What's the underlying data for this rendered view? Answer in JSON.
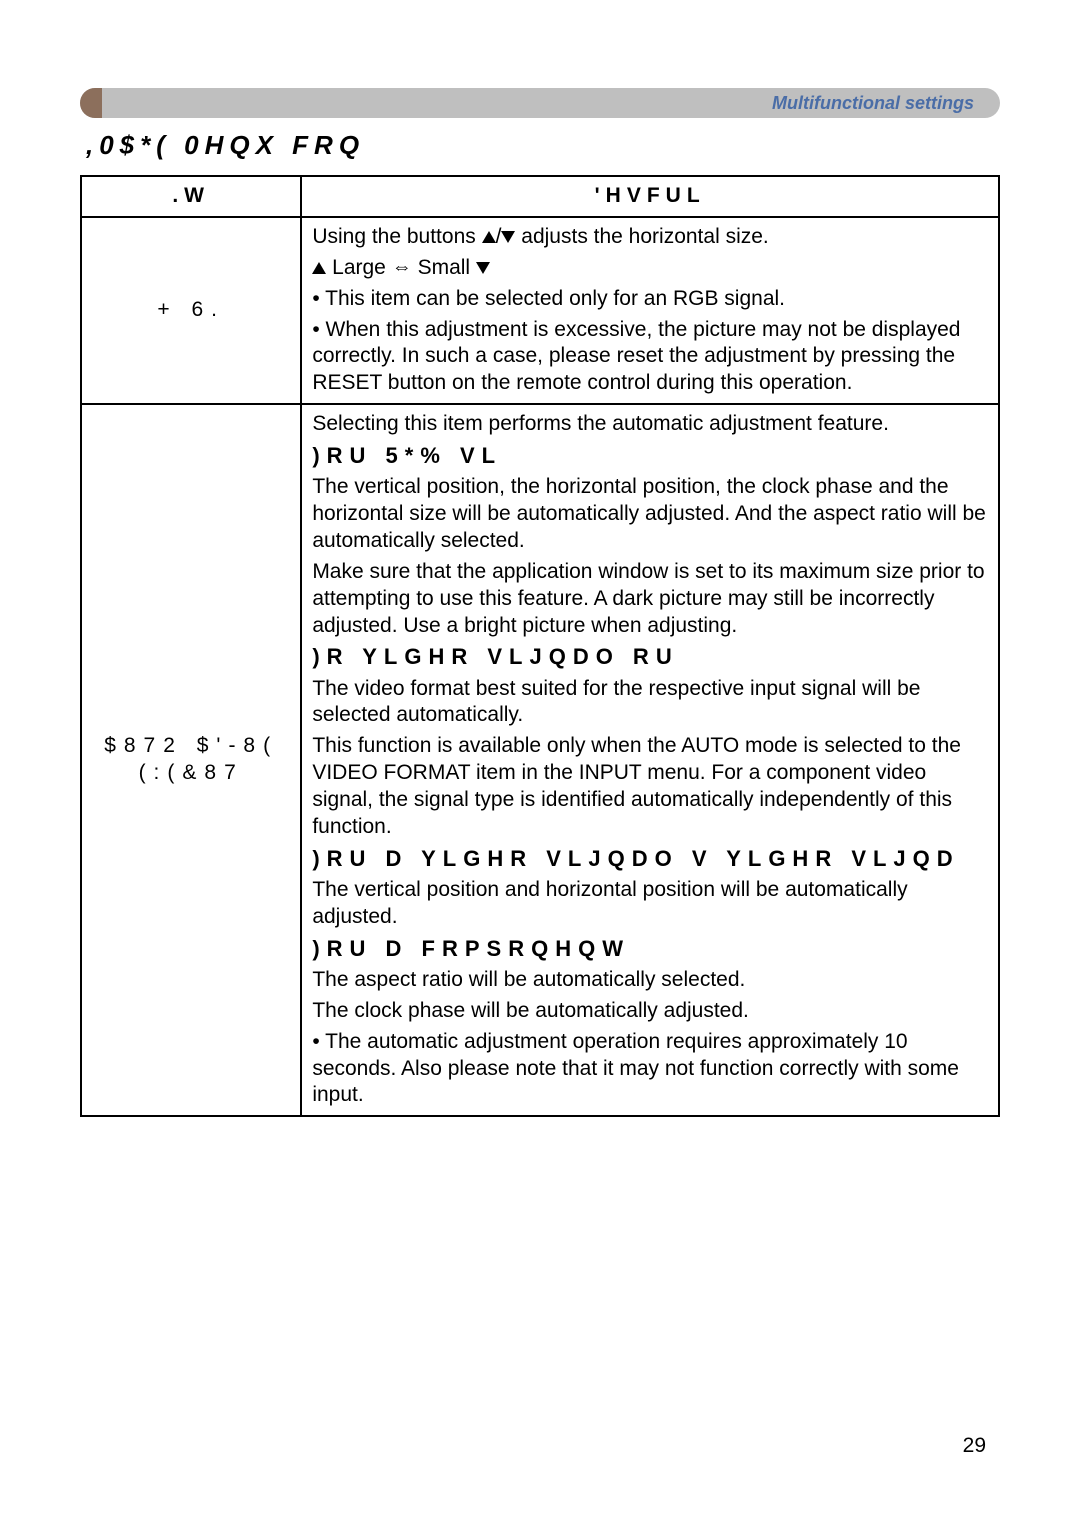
{
  "header": {
    "label": "Multifunctional settings"
  },
  "title": ",0$*( 0HQX FRQ",
  "table": {
    "col_item": ".W",
    "col_desc": "'HVFUL",
    "rows": [
      {
        "item": "+ 6.",
        "desc": {
          "line1_a": "Using the buttons ",
          "line1_b": " adjusts the horizontal size.",
          "line2_large": "Large",
          "line2_small": "Small",
          "note1": "• This item can be selected only for an RGB signal.",
          "note2": "• When this adjustment is excessive, the picture may not be displayed correctly. In such a case, please reset the adjustment by pressing the RESET button on the remote control during this operation."
        }
      },
      {
        "item_line1": "$872 $'-8(",
        "item_line2": "(:(&87",
        "desc": {
          "intro": "Selecting this item performs the automatic adjustment feature.",
          "h1": ")RU    5*% VL",
          "p1": "The vertical position, the horizontal position, the clock phase and the horizontal size will be automatically adjusted. And the aspect ratio will be automatically selected.",
          "p1b": "Make sure that the application window is set to its maximum size prior to attempting to use this feature. A dark picture may still be incorrectly adjusted. Use a bright picture when adjusting.",
          "h2": ")R   YLGHR VLJQDO RU",
          "p2": "The video format best suited for the respective input signal will be selected automatically.",
          "p2b": "This function is available only when the AUTO mode is selected to the VIDEO FORMAT item in the INPUT menu. For a component video signal, the signal type is identified automatically independently of this function.",
          "h3": ")RU D YLGHR VLJQDO   V YLGHR VLJQD",
          "p3": "The vertical position and horizontal position will be automatically adjusted.",
          "h4": ")RU D FRPSRQHQW",
          "p4": "The aspect ratio will be automatically selected.",
          "p4b": "The clock phase will be automatically adjusted.",
          "note": "• The automatic adjustment operation requires approximately 10 seconds. Also please note that it may not function correctly with some input."
        }
      }
    ]
  },
  "page_number": "29"
}
